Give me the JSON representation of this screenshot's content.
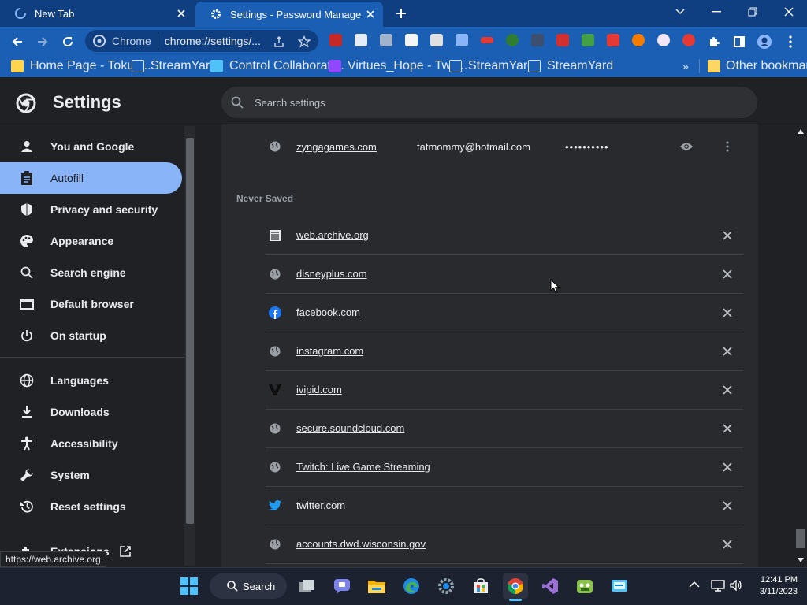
{
  "tabs": [
    {
      "title": "New Tab",
      "active": false
    },
    {
      "title": "Settings - Password Manager",
      "active": true
    }
  ],
  "omnibox": {
    "site": "Chrome",
    "url": "chrome://settings/..."
  },
  "bookmarks": [
    {
      "label": "Home Page - TokuF...",
      "icon": "tokufu-icon"
    },
    {
      "label": "StreamYard",
      "icon": "streamyard-icon"
    },
    {
      "label": "Control Collaborati...",
      "icon": "monitor-icon"
    },
    {
      "label": "Virtues_Hope - Twit...",
      "icon": "twitch-icon"
    },
    {
      "label": "StreamYard",
      "icon": "streamyard-icon"
    },
    {
      "label": "StreamYard",
      "icon": "streamyard-icon"
    },
    {
      "label": "»",
      "icon": ""
    },
    {
      "label": "Other bookmarks",
      "icon": "folder-icon"
    }
  ],
  "settings": {
    "title": "Settings",
    "search_placeholder": "Search settings"
  },
  "sidebar": {
    "items": [
      {
        "label": "You and Google",
        "icon": "person-icon"
      },
      {
        "label": "Autofill",
        "icon": "clipboard-icon",
        "active": true
      },
      {
        "label": "Privacy and security",
        "icon": "shield-icon"
      },
      {
        "label": "Appearance",
        "icon": "palette-icon"
      },
      {
        "label": "Search engine",
        "icon": "search-icon"
      },
      {
        "label": "Default browser",
        "icon": "browser-icon"
      },
      {
        "label": "On startup",
        "icon": "power-icon"
      },
      {
        "label": "Languages",
        "icon": "globe-icon"
      },
      {
        "label": "Downloads",
        "icon": "download-icon"
      },
      {
        "label": "Accessibility",
        "icon": "accessibility-icon"
      },
      {
        "label": "System",
        "icon": "wrench-icon"
      },
      {
        "label": "Reset settings",
        "icon": "history-icon"
      },
      {
        "label": "Extensions",
        "icon": "puzzle-icon"
      }
    ]
  },
  "saved_password": {
    "site": "zyngagames.com",
    "username": "tatmommy@hotmail.com",
    "password_mask": "••••••••••"
  },
  "never_saved": {
    "heading": "Never Saved",
    "sites": [
      {
        "label": "web.archive.org",
        "icon": "archive-icon"
      },
      {
        "label": "disneyplus.com",
        "icon": "globe-icon"
      },
      {
        "label": "facebook.com",
        "icon": "facebook-icon"
      },
      {
        "label": "instagram.com",
        "icon": "globe-icon"
      },
      {
        "label": "ivipid.com",
        "icon": "ivipid-icon"
      },
      {
        "label": "secure.soundcloud.com",
        "icon": "globe-icon"
      },
      {
        "label": "Twitch: Live Game Streaming",
        "icon": "globe-icon"
      },
      {
        "label": "twitter.com",
        "icon": "twitter-icon"
      },
      {
        "label": "accounts.dwd.wisconsin.gov",
        "icon": "globe-icon"
      }
    ]
  },
  "status_url": "https://web.archive.org",
  "taskbar": {
    "search_label": "Search",
    "time": "12:41 PM",
    "date": "3/11/2023"
  },
  "colors": {
    "tabstrip": "#0f3f80",
    "toolbar": "#1a5fb4",
    "accent": "#8ab4f8",
    "page_bg": "#202124",
    "card_bg": "#292a2d"
  }
}
